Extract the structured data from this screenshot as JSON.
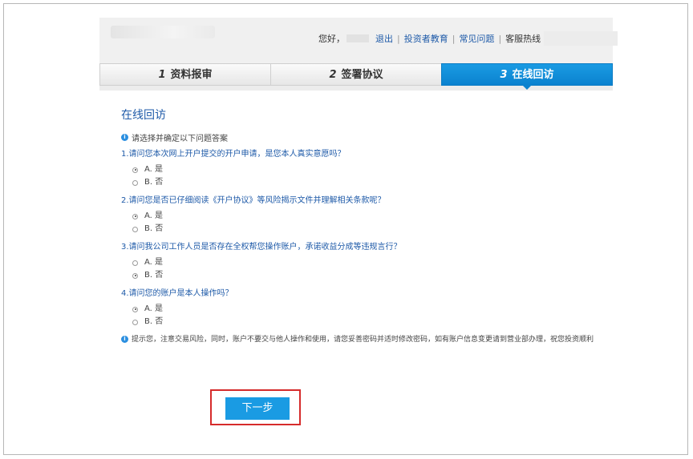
{
  "header": {
    "greeting": "您好，",
    "logout": "退出",
    "investor_edu": "投资者教育",
    "faq": "常见问题",
    "hotline": "客服热线",
    "separator": "|"
  },
  "steps": [
    {
      "num": "1",
      "label": "资料报审"
    },
    {
      "num": "2",
      "label": "签署协议"
    },
    {
      "num": "3",
      "label": "在线回访"
    }
  ],
  "page_title": "在线回访",
  "instruction": "请选择并确定以下问题答案",
  "questions": [
    {
      "text": "1.请问您本次网上开户提交的开户申请，是您本人真实意愿吗？",
      "options": [
        "A. 是",
        "B. 否"
      ],
      "selected": 0
    },
    {
      "text": "2.请问您是否已仔细阅读《开户协议》等风险揭示文件并理解相关条款呢？",
      "options": [
        "A. 是",
        "B. 否"
      ],
      "selected": 0
    },
    {
      "text": "3.请问我公司工作人员是否存在全权帮您操作账户，承诺收益分成等违规言行？",
      "options": [
        "A. 是",
        "B. 否"
      ],
      "selected": 1
    },
    {
      "text": "4.请问您的账户是本人操作吗？",
      "options": [
        "A. 是",
        "B. 否"
      ],
      "selected": 0
    }
  ],
  "notice": "提示您，注意交易风险，同时，账户不要交与他人操作和使用，请您妥善密码并适时修改密码，如有账户信息变更请到营业部办理，祝您投资顺利",
  "next_button": "下一步",
  "colors": {
    "accent": "#1a9be3",
    "link": "#1e5aa8",
    "highlight_border": "#d62b2b"
  }
}
